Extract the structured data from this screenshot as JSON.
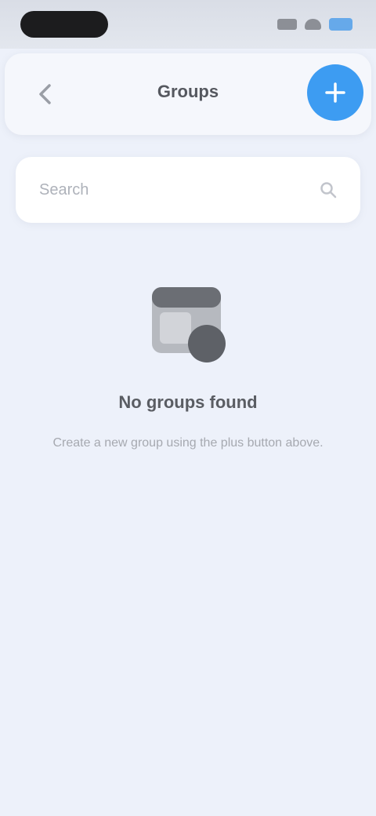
{
  "nav": {
    "title": "Groups"
  },
  "search": {
    "placeholder": "Search"
  },
  "empty_state": {
    "title": "No groups found",
    "description": "Create a new group using the plus button above."
  },
  "colors": {
    "accent": "#3d9cf2",
    "background": "#edf1fa",
    "card": "#f5f7fc",
    "battery": "#66a9ea"
  },
  "icons": {
    "back": "chevron-left-icon",
    "add": "plus-icon",
    "search": "search-icon",
    "empty": "folder-icon"
  }
}
